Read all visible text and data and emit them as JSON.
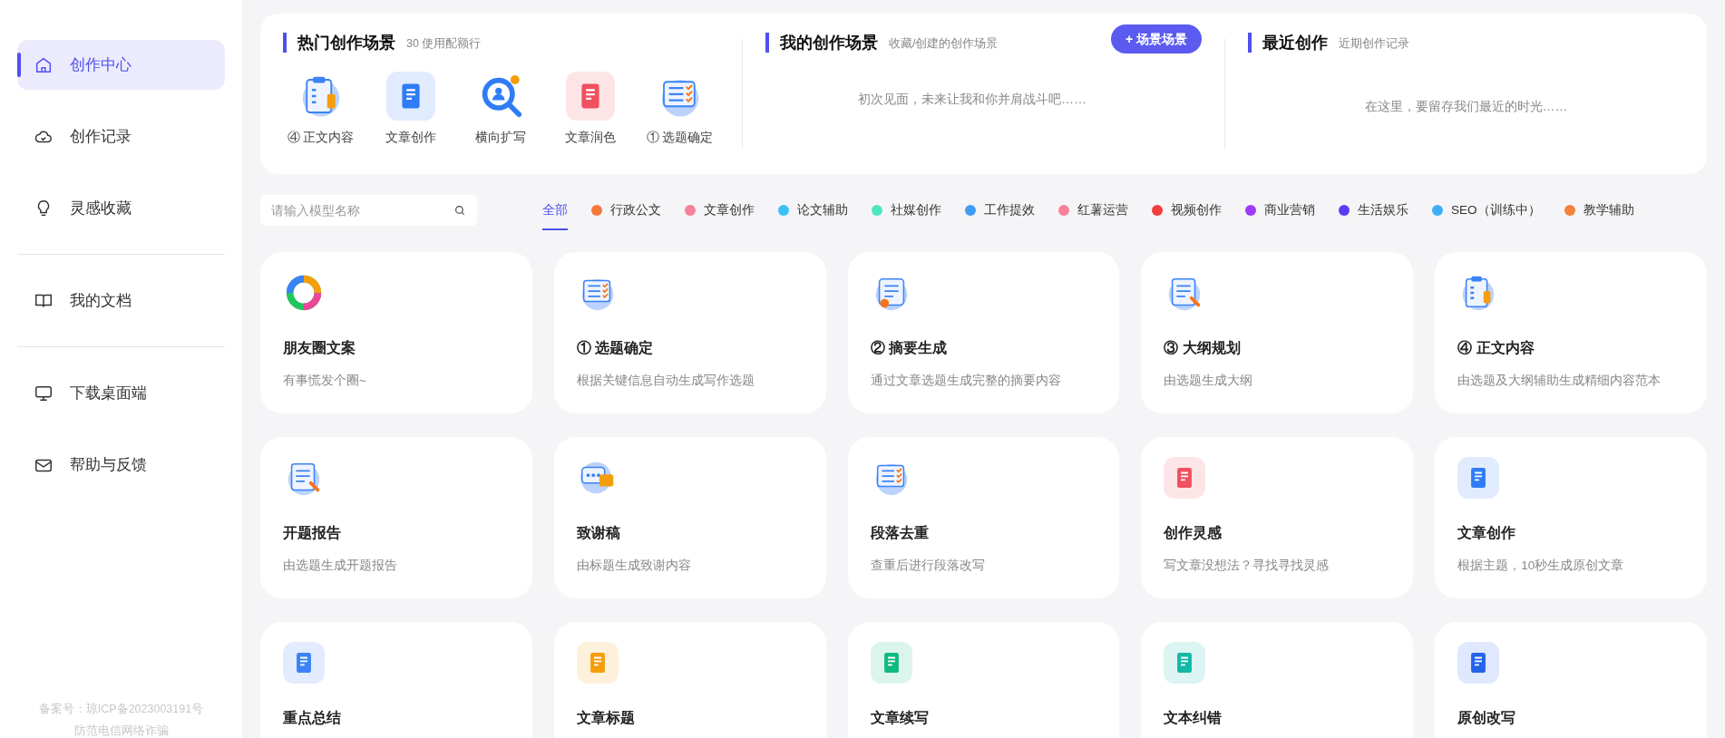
{
  "sidebar": {
    "groups": [
      [
        {
          "label": "创作中心",
          "selected": true
        },
        {
          "label": "创作记录",
          "selected": false
        },
        {
          "label": "灵感收藏",
          "selected": false
        }
      ],
      [
        {
          "label": "我的文档",
          "selected": false
        }
      ],
      [
        {
          "label": "下载桌面端",
          "selected": false
        },
        {
          "label": "帮助与反馈",
          "selected": false
        }
      ]
    ],
    "footer": [
      "备案号：琼ICP备2023003191号",
      "防范电信网络诈骗"
    ]
  },
  "hot_scenes": {
    "title": "热门创作场景",
    "subtitle": "30 使用配额行",
    "items": [
      {
        "label": "④ 正文内容",
        "icon": {
          "kind": "clipboard"
        }
      },
      {
        "label": "文章创作",
        "icon": {
          "kind": "tile",
          "color": "#2f7cf6"
        }
      },
      {
        "label": "横向扩写",
        "icon": {
          "kind": "magnifier",
          "color": "#2f7cf6"
        }
      },
      {
        "label": "文章润色",
        "icon": {
          "kind": "tile",
          "color": "#f0505f"
        }
      },
      {
        "label": "① 选题确定",
        "icon": {
          "kind": "checklist"
        }
      }
    ]
  },
  "my_scenes": {
    "title": "我的创作场景",
    "subtitle": "收藏/创建的创作场景",
    "button": "+ 场景场景",
    "empty": "初次见面，未来让我和你并肩战斗吧……"
  },
  "recent": {
    "title": "最近创作",
    "subtitle": "近期创作记录",
    "empty": "在这里，要留存我们最近的时光……"
  },
  "search": {
    "placeholder": "请输入模型名称"
  },
  "categories": [
    {
      "label": "全部",
      "selected": true
    },
    {
      "label": "行政公文",
      "color": "#f5793b",
      "selected": false
    },
    {
      "label": "文章创作",
      "color": "#f7809b",
      "selected": false
    },
    {
      "label": "论文辅助",
      "color": "#3cc0f5",
      "selected": false
    },
    {
      "label": "社媒创作",
      "color": "#4ee6c0",
      "selected": false
    },
    {
      "label": "工作提效",
      "color": "#3f9cf5",
      "selected": false
    },
    {
      "label": "红薯运营",
      "color": "#f7809b",
      "selected": false
    },
    {
      "label": "视频创作",
      "color": "#f53c3c",
      "selected": false
    },
    {
      "label": "商业营销",
      "color": "#a03cf5",
      "selected": false
    },
    {
      "label": "生活娱乐",
      "color": "#5a3cf5",
      "selected": false
    },
    {
      "label": "SEO（训练中）",
      "color": "#3caef5",
      "selected": false
    },
    {
      "label": "教学辅助",
      "color": "#f5813b",
      "selected": false
    }
  ],
  "cards": [
    {
      "title": "朋友圈文案",
      "description": "有事慌发个圈~",
      "icon": {
        "kind": "ring"
      }
    },
    {
      "title": "① 选题确定",
      "description": "根据关键信息自动生成写作选题",
      "icon": {
        "kind": "checklist"
      }
    },
    {
      "title": "② 摘要生成",
      "description": "通过文章选题生成完整的摘要内容",
      "icon": {
        "kind": "scroll"
      }
    },
    {
      "title": "③ 大纲规划",
      "description": "由选题生成大纲",
      "icon": {
        "kind": "page"
      }
    },
    {
      "title": "④ 正文内容",
      "description": "由选题及大纲辅助生成精细内容范本",
      "icon": {
        "kind": "clipboard"
      }
    },
    {
      "title": "开题报告",
      "description": "由选题生成开题报告",
      "icon": {
        "kind": "page"
      }
    },
    {
      "title": "致谢稿",
      "description": "由标题生成致谢内容",
      "icon": {
        "kind": "chat"
      }
    },
    {
      "title": "段落去重",
      "description": "查重后进行段落改写",
      "icon": {
        "kind": "checklist"
      }
    },
    {
      "title": "创作灵感",
      "description": "写文章没想法？寻找寻找灵感",
      "icon": {
        "kind": "tile",
        "color": "#f0505f"
      }
    },
    {
      "title": "文章创作",
      "description": "根据主题，10秒生成原创文章",
      "icon": {
        "kind": "tile",
        "color": "#2f7cf6"
      }
    },
    {
      "title": "重点总结",
      "icon": {
        "kind": "tile",
        "color": "#3b82f6"
      }
    },
    {
      "title": "文章标题",
      "icon": {
        "kind": "tile",
        "color": "#f59e0b"
      }
    },
    {
      "title": "文章续写",
      "icon": {
        "kind": "tile",
        "color": "#10b981"
      }
    },
    {
      "title": "文本纠错",
      "icon": {
        "kind": "tile",
        "color": "#14b8a6"
      }
    },
    {
      "title": "原创改写",
      "icon": {
        "kind": "tile",
        "color": "#2563eb"
      }
    }
  ]
}
